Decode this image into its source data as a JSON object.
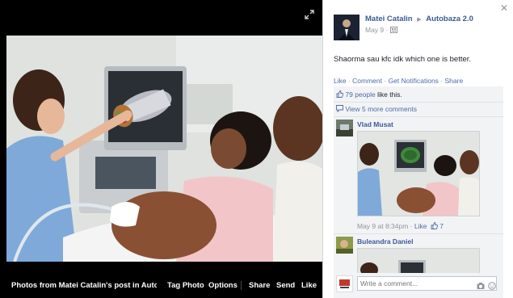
{
  "theater": {
    "caption": "Photos from Matei Catalin's post in Autob…",
    "actions": {
      "tag_photo": "Tag Photo",
      "options": "Options",
      "share": "Share",
      "send": "Send",
      "like": "Like"
    }
  },
  "post": {
    "author": "Matei Catalin",
    "group": "Autobaza 2.0",
    "date": "May 9 ·",
    "text": "Shaorma sau kfc idk which one is better.",
    "actions": {
      "like": "Like",
      "comment": "Comment",
      "notifications": "Get Notifications",
      "share": "Share",
      "separator": " · "
    }
  },
  "feedback": {
    "likes_link": "79 people",
    "likes_rest": " like this.",
    "view_more": "View 5 more comments",
    "comments": [
      {
        "author": "Vlad Musat",
        "time": "May 9 at 8:34pm",
        "sep": " · ",
        "like": "Like",
        "like_count": "7"
      },
      {
        "author": "Buleandra Daniel"
      }
    ],
    "write_placeholder": "Write a comment..."
  },
  "icons": {
    "expand": "expand-icon",
    "close": "close-icon",
    "audience": "group-audience-icon",
    "thumb": "thumbs-up-icon",
    "comment": "comment-icon",
    "camera": "camera-icon",
    "emoji": "emoji-icon"
  },
  "colors": {
    "link": "#4b6ea8",
    "name": "#3b5998",
    "meta": "#90949c",
    "panel_bg": "#f2f3f5",
    "theater_bg": "#000000"
  }
}
